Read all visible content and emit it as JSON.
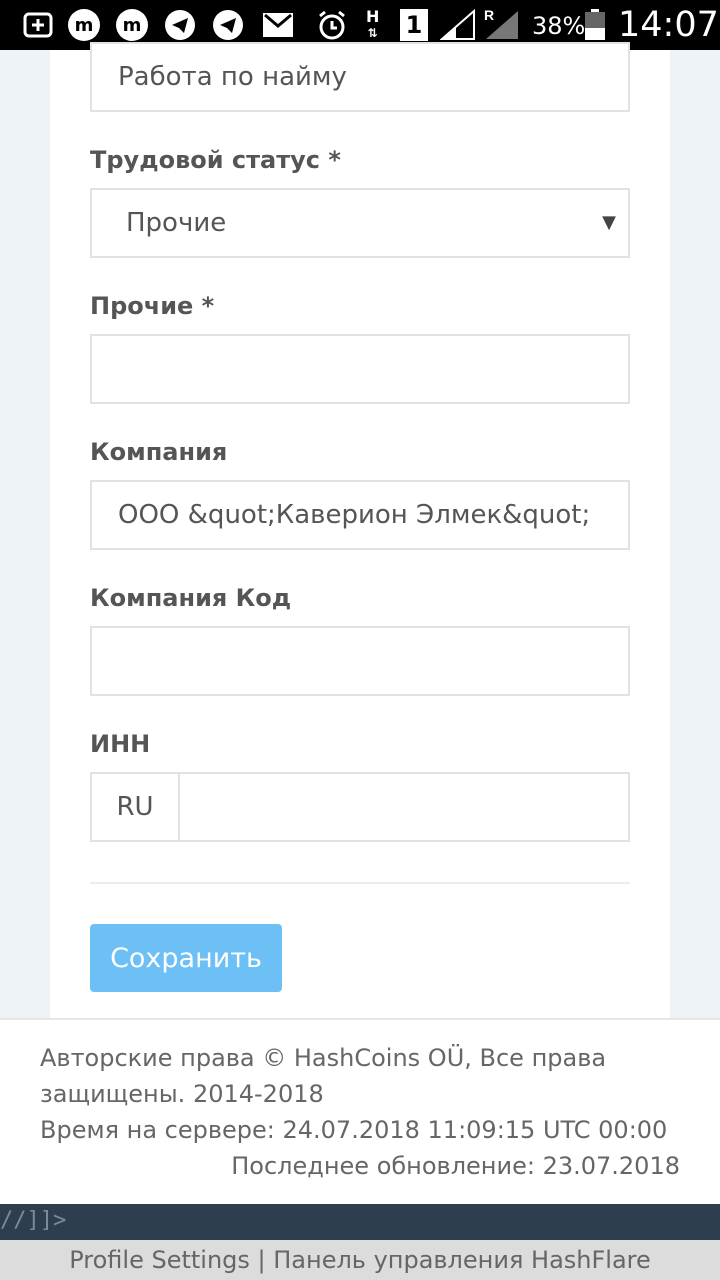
{
  "status_bar": {
    "icons": [
      "plus-box-icon",
      "messenger-icon",
      "messenger-icon",
      "telegram-icon",
      "telegram-icon",
      "gmail-icon",
      "alarm-icon",
      "network-h-icon",
      "sim-1-icon",
      "signal-icon",
      "signal-roaming-icon",
      "battery-icon"
    ],
    "h_label": "H",
    "sim_label": "1",
    "roaming_label": "R",
    "battery_percent": "38%",
    "time": "14:07"
  },
  "form": {
    "employment_value": "Работа по найму",
    "labor_status_label": "Трудовой статус *",
    "labor_status_value": "Прочие",
    "other_label": "Прочие *",
    "other_value": "",
    "company_label": "Компания",
    "company_value": "ООО &quot;Каверион Элмек&quot;",
    "company_code_label": "Компания Код",
    "company_code_value": "",
    "inn_label": "ИНН",
    "inn_prefix": "RU",
    "inn_value": "",
    "save_label": "Сохранить"
  },
  "footer": {
    "copyright_line1": "Авторские права © HashCoins OÜ, Все права",
    "copyright_line2": "защищены. 2014-2018",
    "server_time": "Время на сервере: 24.07.2018 11:09:15 UTC 00:00",
    "last_update": "Последнее обновление: 23.07.2018"
  },
  "debug_text": "//]]>",
  "browser_title": "Profile Settings | Панель управления HashFlare",
  "colors": {
    "accent_button": "#6cc0f5",
    "dark_bar": "#2d3e4e"
  }
}
